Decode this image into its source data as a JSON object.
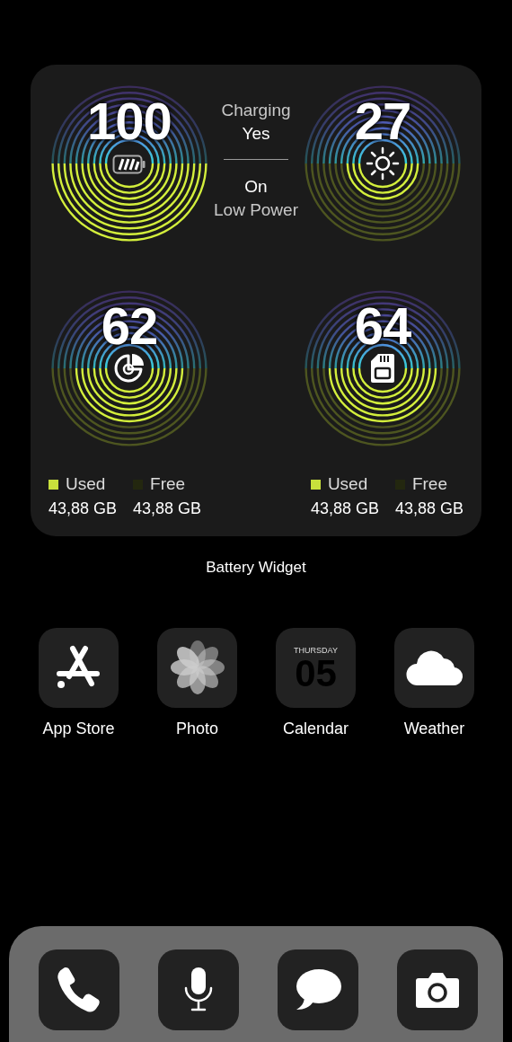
{
  "widget": {
    "gauges": [
      {
        "kind": "battery",
        "value": "100"
      },
      {
        "kind": "brightness",
        "value": "27"
      },
      {
        "kind": "storage",
        "value": "62"
      },
      {
        "kind": "sd-card",
        "value": "64"
      }
    ],
    "status": {
      "charging_label": "Charging",
      "charging_value": "Yes",
      "low_power_value": "On",
      "low_power_label": "Low Power"
    },
    "legends": [
      [
        {
          "label": "Used",
          "color": "#c8e03c",
          "amount": "43,88 GB"
        },
        {
          "label": "Free",
          "color": "#23270f",
          "amount": "43,88 GB"
        }
      ],
      [
        {
          "label": "Used",
          "color": "#c8e03c",
          "amount": "43,88 GB"
        },
        {
          "label": "Free",
          "color": "#23270f",
          "amount": "43,88 GB"
        }
      ]
    ]
  },
  "widget_caption": "Battery Widget",
  "apps": [
    {
      "kind": "app-store",
      "label": "App Store"
    },
    {
      "kind": "photos",
      "label": "Photo"
    },
    {
      "kind": "calendar",
      "label": "Calendar",
      "weekday": "THURSDAY",
      "day": "05"
    },
    {
      "kind": "weather",
      "label": "Weather"
    }
  ],
  "dock": [
    {
      "kind": "phone"
    },
    {
      "kind": "microphone"
    },
    {
      "kind": "messages"
    },
    {
      "kind": "camera"
    }
  ]
}
